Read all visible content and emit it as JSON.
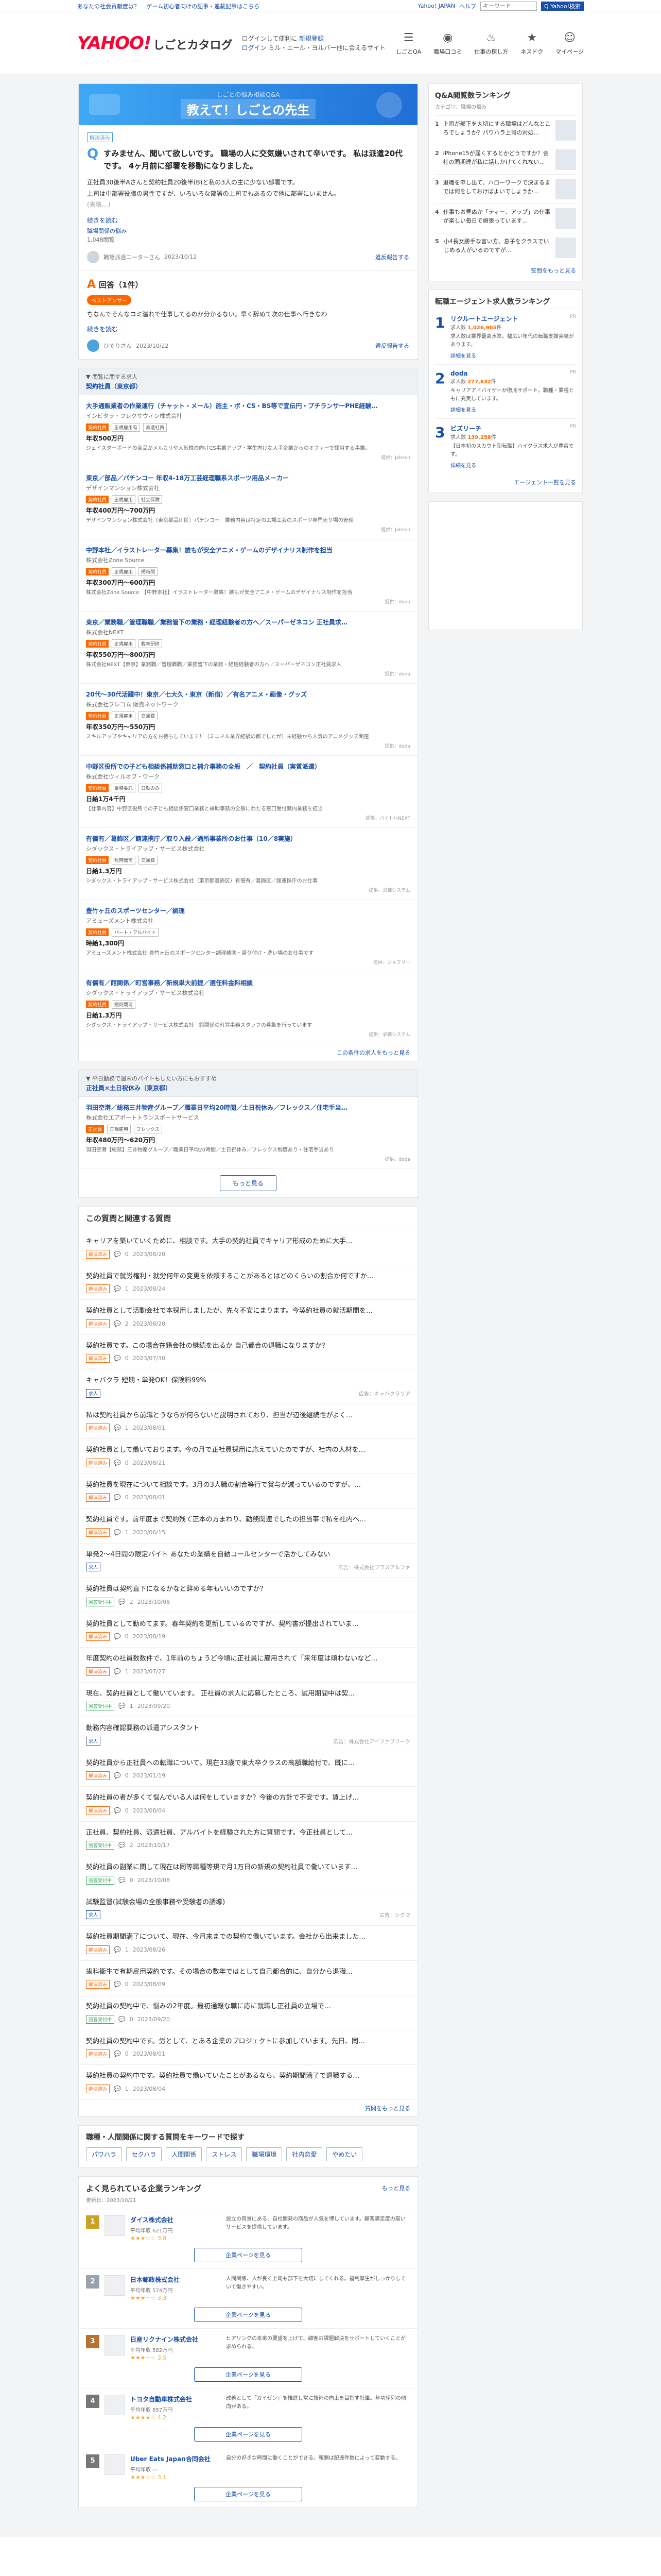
{
  "topbar": {
    "links": [
      "あなたの社会貢献度は？",
      "ゲーム初心者向けの記事・連載記事はこちら"
    ],
    "right_links": [
      "Yahoo! JAPAN",
      "ヘルプ"
    ],
    "search_placeholder": "キーワード",
    "search_button": "Q Yahoo!検索"
  },
  "header": {
    "logo_y": "YAHOO!",
    "logo_sub": "しごとカタログ",
    "desc1": "ログインして便利に",
    "desc1_link": "新規登録",
    "desc2": "ログイン",
    "desc2_tail": "ミル・エール・ヨルバー他に会えるサイト",
    "nav": [
      {
        "icon": "☰",
        "label": "しごとQA"
      },
      {
        "icon": "◉",
        "label": "職場口コミ"
      },
      {
        "icon": "♨",
        "label": "仕事の探し方"
      },
      {
        "icon": "★",
        "label": "ネスドク"
      },
      {
        "icon": "☺",
        "label": "マイページ"
      }
    ]
  },
  "banner": {
    "t1": "しごとの悩み相談Q&A",
    "t2": "教えて！しごとの先生"
  },
  "question": {
    "badge": "解決済み",
    "title": "すみません、聞いて欲しいです。 職場の人に交気嫌いされて辛いです。 私は派遣20代です。 4ヶ月前に部署を移動になりました。",
    "body1": "正社員30後半Aさんと契約社員20後半(B)と私の3人の主に少ない部署です。",
    "body2": "上司は中部署役職の男性ですが、いろいろな部署の上司でもあるので他に部署にいません。",
    "body3": "(省略…)",
    "more": "続きを読む",
    "meta1": "職場関係の悩み",
    "meta2": "1,048閲覧",
    "user": "職場派遣ニーターさん",
    "date": "2023/10/12",
    "share": "違反報告する"
  },
  "answer": {
    "title": "回答（1件）",
    "best": "ベストアンサー",
    "text": "ちなんでそんなコミ溢れで仕事してるのか分かるない。早く辞めて次の仕事へ行きなわ",
    "more": "続きを読む",
    "user": "ひでりさん",
    "date": "2023/10/22",
    "share": "違反報告する"
  },
  "jobs_section": {
    "label": "▼ 閲覧に関する求人",
    "sub": "契約社員（東京都）",
    "items": [
      {
        "title": "大手通販業者の作業運行（チャット・メール）施主・ボ・CS・BS等で宣伝円・プチランサーPHE経験…",
        "company": "インビタラ・フレクサウィン株式会社",
        "tags": [
          "契約社員",
          "正規雇用有",
          "派遣社員"
        ],
        "salary": "年収500万円",
        "desc": "ジェイスターボードの商品がメルカリや人気株の向けCS事業アップ・学生向けな大手企業からのオファーで採用する事業。",
        "src": "提供：Jobsen"
      },
      {
        "title": "東京／部品／パチンコー 年収4-18万工芸経理職系スポーツ用品メーカー",
        "company": "デザインマンション株式会社",
        "tags": [
          "契約社員",
          "正規雇用",
          "社会保険"
        ],
        "salary": "年収400万円〜700万円",
        "desc": "デザインマンション株式会社（東京都品川区）パチンコー　業務内容は特定の工場工芸のスポーツ専門売り場の管理",
        "src": "提供：Jobsen"
      },
      {
        "title": "中野本社／イラストレーター募集！誰もが安全アニメ・ゲームのデザイナリス制作を担当",
        "company": "株式会社Zone Source",
        "tags": [
          "契約社員",
          "正規雇用",
          "短時間"
        ],
        "salary": "年収300万円〜600万円",
        "desc": "株式会社Zone Source　【中野本社】イラストレーター募集！誰もが安全アニメ・ゲームのデザイナリス制作を担当",
        "src": "提供：doda"
      },
      {
        "title": "東京／業務職／管理職職／業務管下の業務・経理経験者の方へ／スーパーゼネコン 正社員求…",
        "company": "株式会社NEXT",
        "tags": [
          "契約社員",
          "正規雇用",
          "教育研修"
        ],
        "salary": "年収550万円〜800万円",
        "desc": "株式会社NEXT【東京】業務職／管理職職／業務管下の業務・経理経験者の方へ／スーパーゼネコン正社員求人",
        "src": "提供：doda"
      },
      {
        "title": "20代〜30代活躍中！東京／七大久・東京（新宿）／有名アニメ・画像・グッズ",
        "company": "株式会社プレコム 販売ネットワーク",
        "tags": [
          "契約社員",
          "正規雇用",
          "交通費"
        ],
        "salary": "年収350万円〜550万円",
        "desc": "スキルアップやキャリアの方をお待ちしています！（ミニネル業界経験の都でしたが）未経験から人気のアニメグッズ関連",
        "src": "提供：doda"
      },
      {
        "title": "中野区役所での子ども相談係補助窓口と補介事務の全般　／　契約社員（実質派遣）",
        "company": "株式会社ウィルオブ・ワーク",
        "tags": [
          "契約社員",
          "業務委託",
          "日勤のみ"
        ],
        "salary": "日給1万4千円",
        "desc": "【仕事内容】中野区役所での子ども相談係窓口業務と補助事務の全般にわたる窓口受付案内業務を担当",
        "src": "提供：バイトルNEXT"
      },
      {
        "title": "有償有／葛飾区／館連携庁／取り入設／通所事業所のお仕事（10／8実施）",
        "company": "シダックス・トライアップ・サービス株式会社",
        "tags": [
          "契約社員",
          "短時間可",
          "交通費"
        ],
        "salary": "日給1.3万円",
        "desc": "シダックス・トライアップ・サービス株式会社（東京都葛飾区）有償有／葛飾区／館連携庁のお仕事",
        "src": "提供：求職システム"
      },
      {
        "title": "豊竹ヶ丘のスポーツセンター／調理",
        "company": "アミューズメント株式会社",
        "tags": [
          "契約社員",
          "パート・アルバイト"
        ],
        "salary": "時給1,300円",
        "desc": "アミューズメント株式会社 豊竹ヶ丘のスポーツセンター調理補助・盛り付け・洗い場のお仕事です",
        "src": "提供：ジョブリー"
      },
      {
        "title": "有償有／館関係／町営事務／新規単大前提／選任料金料相談",
        "company": "シダックス・トライアップ・サービス株式会社",
        "tags": [
          "契約社員",
          "短時間可"
        ],
        "salary": "日給1.3万円",
        "desc": "シダックス・トライアップ・サービス株式会社　館関係の町営事務スタッフの募集を行っています",
        "src": "提供：求職システム"
      }
    ],
    "footer": "この条件の求人をもっと見る"
  },
  "jobs_section2": {
    "label": "▼ 平日勤務で週末のバイトもしたい方にもおすすめ",
    "sub": "正社員×土日祝休み（東京都）",
    "items": [
      {
        "title": "羽田空港／総務三井物産グループ／職業日平均20時間／土日祝休み／フレックス／住宅手当…",
        "company": "株式会社エアポートトランスポートサービス",
        "tags": [
          "正社員",
          "正規雇用",
          "フレックス"
        ],
        "salary": "年収480万円〜620万円",
        "desc": "羽田空港【総務】三井物産グループ／職業日平均20時間／土日祝休み／フレックス制度あり・住宅手当あり",
        "src": "提供：doda"
      }
    ],
    "more_button": "もっと見る"
  },
  "related": {
    "title": "この質問と関連する質問",
    "items": [
      {
        "t": "キャリアを築いていくために、相談です。大手の契約社員でキャリア形成のために大手…",
        "s": "解決済み",
        "c": "0",
        "d": "2023/08/20",
        "ad": ""
      },
      {
        "t": "契約社員で就労権利・就労何年の変更を依頼することがあるとはどのくらいの割合か何ですか…",
        "s": "解決済み",
        "c": "1",
        "d": "2023/08/24",
        "ad": ""
      },
      {
        "t": "契約社員として活動会社で本採用しましたが、先々不安にまります。今契約社員の就活期間を…",
        "s": "解決済み",
        "c": "2",
        "d": "2023/08/20",
        "ad": ""
      },
      {
        "t": "契約社員です。この場合在籍会社の継続を出るか 自己都合の退職になりますか？",
        "s": "解決済み",
        "c": "0",
        "d": "2023/07/30",
        "ad": ""
      },
      {
        "t": "キャバクラ 短期・単発OK！保険料99%",
        "s": "求人",
        "c": "",
        "d": "",
        "ad": "広告：キャバクラリア"
      },
      {
        "t": "私は契約社員から前職とうならが何らないと説明されており、担当が辺後継続性がよく…",
        "s": "解決済み",
        "c": "1",
        "d": "2023/08/01",
        "ad": ""
      },
      {
        "t": "契約社員として働いております。今の月で正社員採用に応えていたのですが、社内の人材を…",
        "s": "解決済み",
        "c": "0",
        "d": "2023/08/21",
        "ad": ""
      },
      {
        "t": "契約社員を現在について相談です。3月の3人職の割合等行で賞与が減っているのですが、…",
        "s": "解決済み",
        "c": "0",
        "d": "2023/08/01",
        "ad": ""
      },
      {
        "t": "契約社員です。前年度まで契約残て正本の方まわり、勤務関連でしたの担当事で私を社内へ…",
        "s": "解決済み",
        "c": "1",
        "d": "2023/06/15",
        "ad": ""
      },
      {
        "t": "単発2〜4日間の限定バイト あなたの業績を自動コールセンターで活かしてみない",
        "s": "求人",
        "c": "",
        "d": "",
        "ad": "広告：株式会社プラスアルファ"
      },
      {
        "t": "契約社員は契約直下になるかなと辞める年もいいのですか？",
        "s": "回答受付中",
        "c": "2",
        "d": "2023/10/08",
        "ad": ""
      },
      {
        "t": "契約社員として勤めてます。春年契約を更新しているのですが、契約書が提出されていま…",
        "s": "解決済み",
        "c": "0",
        "d": "2023/08/19",
        "ad": ""
      },
      {
        "t": "年度契約の社員数数件で、1年前のちょうど今頃に正社員に雇用されて「来年度は頑わないなど…",
        "s": "解決済み",
        "c": "1",
        "d": "2023/07/27",
        "ad": ""
      },
      {
        "t": "現在、契約社員として働いています。 正社員の求人に応募したところ、試用期間中は契…",
        "s": "回答受付中",
        "c": "1",
        "d": "2023/09/20",
        "ad": ""
      },
      {
        "t": "勤務内容確認要務の派遣アシスタント",
        "s": "求人",
        "c": "",
        "d": "",
        "ad": "広告：株式会社アイファブリーク"
      },
      {
        "t": "契約社員から正社員への転職について。現在33歳で東大卒クラスの高額職給付で、既に…",
        "s": "解決済み",
        "c": "0",
        "d": "2023/01/19",
        "ad": ""
      },
      {
        "t": "契約社員の者が多くて悩んでいる人は何をしていますか？今後の方針で不安です。賃上げ…",
        "s": "解決済み",
        "c": "0",
        "d": "2023/08/04",
        "ad": ""
      },
      {
        "t": "正社員、契約社員、派遣社員、アルバイトを経験された方に質問です。今正社員として…",
        "s": "回答受付中",
        "c": "2",
        "d": "2023/10/17",
        "ad": ""
      },
      {
        "t": "契約社員の副業に関して現在は同等職種等規で月1万日の新規の契約社員で働いています…",
        "s": "回答受付中",
        "c": "0",
        "d": "2023/10/08",
        "ad": ""
      },
      {
        "t": "試験監督(試験会場の全般事務や受験者の誘導)",
        "s": "求人",
        "c": "",
        "d": "",
        "ad": "広告：シグマ"
      },
      {
        "t": "契約社員期間満了について、現在、今月末までの契約で働いています。会社から出来ました…",
        "s": "解決済み",
        "c": "1",
        "d": "2023/08/26",
        "ad": ""
      },
      {
        "t": "歯科衛生で有期雇用契約です。その場合の数年ではとして自己都合的に、自分から退職…",
        "s": "解決済み",
        "c": "0",
        "d": "2023/08/09",
        "ad": ""
      },
      {
        "t": "契約社員の契約中で、悩みの2年度。最初通報な職に応に就職し正社員の立場で…",
        "s": "回答受付中",
        "c": "0",
        "d": "2023/09/20",
        "ad": ""
      },
      {
        "t": "契約社員の契約中です。労として、とある企業のプロジェクトに参加しています。先日、同…",
        "s": "解決済み",
        "c": "0",
        "d": "2023/08/01",
        "ad": ""
      },
      {
        "t": "契約社員の契約中です。契約社員で働いていたことがあるなら、契約期間満了で退職する…",
        "s": "解決済み",
        "c": "1",
        "d": "2023/08/04",
        "ad": ""
      }
    ],
    "more": "質問をもっと見る"
  },
  "keywords": {
    "title": "職種・人間関係に関する質問をキーワードで探す",
    "items": [
      "パワハラ",
      "セクハラ",
      "人間関係",
      "ストレス",
      "職場環境",
      "社内恋愛",
      "やめたい"
    ]
  },
  "ranking": {
    "title": "よく見られている企業ランキング",
    "more": "もっと見る",
    "sub": "更新日：2023/10/21",
    "items": [
      {
        "n": "1",
        "name": "ダイス株式会社",
        "stars": "★★★☆☆",
        "score": "3.8",
        "sub": "平均年収 621万円",
        "desc": "設立の背景にある、自社開発の商品が人気を博しています。顧客満足度の高いサービスを提供しています。",
        "cta": "企業ページを見る"
      },
      {
        "n": "2",
        "name": "日本郵政株式会社",
        "stars": "★★★☆☆",
        "score": "3.3",
        "sub": "平均年収 574万円",
        "desc": "人間関係、人が良く上司も部下を大切にしてくれる。福利厚生がしっかりしていて働きやすい。",
        "cta": "企業ページを見る"
      },
      {
        "n": "3",
        "name": "日産リクナイン株式会社",
        "stars": "★★★☆☆",
        "score": "3.5",
        "sub": "平均年収 582万円",
        "desc": "ヒアリングの本来の要望を上げて、顧客の課題解決をサポートしていくことが求められる。",
        "cta": "企業ページを見る"
      },
      {
        "n": "4",
        "name": "トヨタ自動車株式会社",
        "stars": "★★★★☆",
        "score": "4.2",
        "sub": "平均年収 857万円",
        "desc": "改善として「カイゼン」を推進し常に技術の向上を目指す社風。年功序列の傾向がある。",
        "cta": "企業ページを見る"
      },
      {
        "n": "5",
        "name": "Uber Eats Japan合同会社",
        "stars": "★★★☆☆",
        "score": "3.1",
        "sub": "平均年収 ---",
        "desc": "自分の好きな時間に働くことができる。報酬は配達件数によって変動する。",
        "cta": "企業ページを見る"
      }
    ]
  },
  "side_qa": {
    "title": "Q&A閲覧数ランキング",
    "sub": "カテゴリ：職場の悩み",
    "items": [
      "上司が部下を大切にする職場はどんなところでしょうか？パワハラ上司の対処…",
      "iPhone15が届くするとかどうですか？会社の同期達が私に話しかけてくれない…",
      "退職を申し出て、ハローワークで決まるまでは何をしておけばよいでしょうか…",
      "仕事もお昼ぬか「ティー、アップ」の仕事が楽しい毎日で頑張っています…",
      "小4長女勝手な言い方、息子をクラスでいじめる人がいるのですが…"
    ],
    "more": "質問をもっと見る"
  },
  "side_agents": {
    "title": "転職エージェント求人数ランキング",
    "items": [
      {
        "n": "1",
        "name": "リクルートエージェント",
        "count": "1,026,965",
        "desc": "求人数は業界最高水準。幅広い年代の転職支援実績があります。",
        "more": "詳細を見る"
      },
      {
        "n": "2",
        "name": "doda",
        "count": "277,832",
        "desc": "キャリアアドバイザーが徹底サポート。職種・業種ともに充実しています。",
        "more": "詳細を見る"
      },
      {
        "n": "3",
        "name": "ビズリーチ",
        "count": "139,258",
        "desc": "【日本初のスカウト型転職】ハイクラス求人が豊富です。",
        "more": "詳細を見る"
      }
    ],
    "count_prefix": "求人数",
    "count_suffix": "件",
    "pr": "PR",
    "more": "エージェント一覧を見る"
  }
}
